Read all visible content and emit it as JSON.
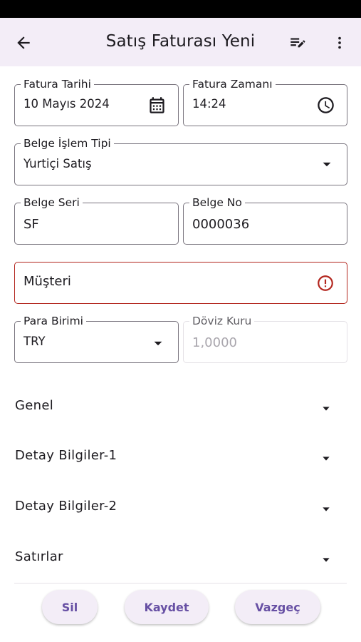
{
  "app_bar": {
    "title": "Satış Faturası Yeni",
    "icons": [
      "arrow-back-icon",
      "edit-note-icon",
      "more-vert-icon"
    ]
  },
  "form": {
    "invoice_date": {
      "label": "Fatura Tarihi",
      "value": "10 Mayıs 2024",
      "icon": "calendar-icon"
    },
    "invoice_time": {
      "label": "Fatura Zamanı",
      "value": "14:24",
      "icon": "clock-icon"
    },
    "doc_type": {
      "label": "Belge İşlem Tipi",
      "value": "Yurtiçi Satış",
      "icon": "dropdown-arrow-icon"
    },
    "doc_series": {
      "label": "Belge Seri",
      "value": "SF"
    },
    "doc_no": {
      "label": "Belge No",
      "value": "0000036"
    },
    "customer": {
      "placeholder": "Müşteri",
      "icon": "error-icon"
    },
    "currency": {
      "label": "Para Birimi",
      "value": "TRY",
      "icon": "dropdown-arrow-icon"
    },
    "exchange_rate": {
      "label": "Döviz Kuru",
      "value": "1,0000"
    }
  },
  "sections": [
    {
      "title": "Genel"
    },
    {
      "title": "Detay Bilgiler-1"
    },
    {
      "title": "Detay Bilgiler-2"
    },
    {
      "title": "Satırlar"
    }
  ],
  "buttons": {
    "delete": "Sil",
    "save": "Kaydet",
    "cancel": "Vazgeç"
  },
  "colors": {
    "app_bar_bg": "#f3edf7",
    "primary": "#6750a4",
    "error": "#b3261e",
    "outline": "#79747e"
  }
}
